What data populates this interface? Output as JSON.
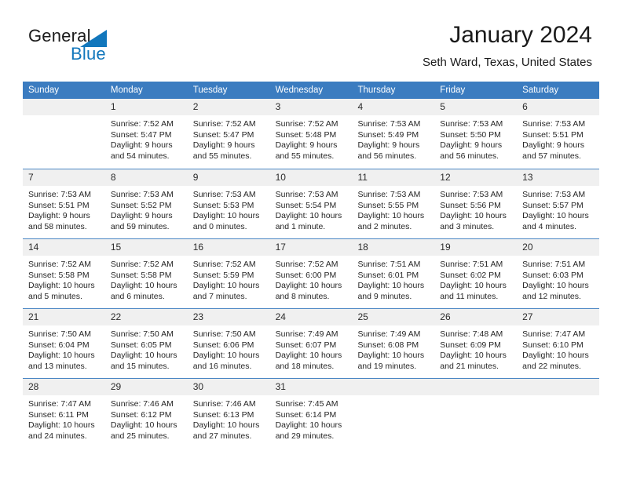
{
  "brand": {
    "word_one": "General",
    "word_two": "Blue",
    "triangle_icon": "triangle-logo-icon",
    "accent_color": "#1277bc"
  },
  "header": {
    "title": "January 2024",
    "subtitle": "Seth Ward, Texas, United States"
  },
  "theme": {
    "header_band": "#3b7cc0",
    "day_strip": "#f0f0f0",
    "row_divider": "#4a86c4",
    "text": "#262626"
  },
  "weekdays": [
    "Sunday",
    "Monday",
    "Tuesday",
    "Wednesday",
    "Thursday",
    "Friday",
    "Saturday"
  ],
  "weeks": [
    [
      {
        "day": "",
        "sunrise": "",
        "sunset": "",
        "daylight": ""
      },
      {
        "day": "1",
        "sunrise": "Sunrise: 7:52 AM",
        "sunset": "Sunset: 5:47 PM",
        "daylight": "Daylight: 9 hours and 54 minutes."
      },
      {
        "day": "2",
        "sunrise": "Sunrise: 7:52 AM",
        "sunset": "Sunset: 5:47 PM",
        "daylight": "Daylight: 9 hours and 55 minutes."
      },
      {
        "day": "3",
        "sunrise": "Sunrise: 7:52 AM",
        "sunset": "Sunset: 5:48 PM",
        "daylight": "Daylight: 9 hours and 55 minutes."
      },
      {
        "day": "4",
        "sunrise": "Sunrise: 7:53 AM",
        "sunset": "Sunset: 5:49 PM",
        "daylight": "Daylight: 9 hours and 56 minutes."
      },
      {
        "day": "5",
        "sunrise": "Sunrise: 7:53 AM",
        "sunset": "Sunset: 5:50 PM",
        "daylight": "Daylight: 9 hours and 56 minutes."
      },
      {
        "day": "6",
        "sunrise": "Sunrise: 7:53 AM",
        "sunset": "Sunset: 5:51 PM",
        "daylight": "Daylight: 9 hours and 57 minutes."
      }
    ],
    [
      {
        "day": "7",
        "sunrise": "Sunrise: 7:53 AM",
        "sunset": "Sunset: 5:51 PM",
        "daylight": "Daylight: 9 hours and 58 minutes."
      },
      {
        "day": "8",
        "sunrise": "Sunrise: 7:53 AM",
        "sunset": "Sunset: 5:52 PM",
        "daylight": "Daylight: 9 hours and 59 minutes."
      },
      {
        "day": "9",
        "sunrise": "Sunrise: 7:53 AM",
        "sunset": "Sunset: 5:53 PM",
        "daylight": "Daylight: 10 hours and 0 minutes."
      },
      {
        "day": "10",
        "sunrise": "Sunrise: 7:53 AM",
        "sunset": "Sunset: 5:54 PM",
        "daylight": "Daylight: 10 hours and 1 minute."
      },
      {
        "day": "11",
        "sunrise": "Sunrise: 7:53 AM",
        "sunset": "Sunset: 5:55 PM",
        "daylight": "Daylight: 10 hours and 2 minutes."
      },
      {
        "day": "12",
        "sunrise": "Sunrise: 7:53 AM",
        "sunset": "Sunset: 5:56 PM",
        "daylight": "Daylight: 10 hours and 3 minutes."
      },
      {
        "day": "13",
        "sunrise": "Sunrise: 7:53 AM",
        "sunset": "Sunset: 5:57 PM",
        "daylight": "Daylight: 10 hours and 4 minutes."
      }
    ],
    [
      {
        "day": "14",
        "sunrise": "Sunrise: 7:52 AM",
        "sunset": "Sunset: 5:58 PM",
        "daylight": "Daylight: 10 hours and 5 minutes."
      },
      {
        "day": "15",
        "sunrise": "Sunrise: 7:52 AM",
        "sunset": "Sunset: 5:58 PM",
        "daylight": "Daylight: 10 hours and 6 minutes."
      },
      {
        "day": "16",
        "sunrise": "Sunrise: 7:52 AM",
        "sunset": "Sunset: 5:59 PM",
        "daylight": "Daylight: 10 hours and 7 minutes."
      },
      {
        "day": "17",
        "sunrise": "Sunrise: 7:52 AM",
        "sunset": "Sunset: 6:00 PM",
        "daylight": "Daylight: 10 hours and 8 minutes."
      },
      {
        "day": "18",
        "sunrise": "Sunrise: 7:51 AM",
        "sunset": "Sunset: 6:01 PM",
        "daylight": "Daylight: 10 hours and 9 minutes."
      },
      {
        "day": "19",
        "sunrise": "Sunrise: 7:51 AM",
        "sunset": "Sunset: 6:02 PM",
        "daylight": "Daylight: 10 hours and 11 minutes."
      },
      {
        "day": "20",
        "sunrise": "Sunrise: 7:51 AM",
        "sunset": "Sunset: 6:03 PM",
        "daylight": "Daylight: 10 hours and 12 minutes."
      }
    ],
    [
      {
        "day": "21",
        "sunrise": "Sunrise: 7:50 AM",
        "sunset": "Sunset: 6:04 PM",
        "daylight": "Daylight: 10 hours and 13 minutes."
      },
      {
        "day": "22",
        "sunrise": "Sunrise: 7:50 AM",
        "sunset": "Sunset: 6:05 PM",
        "daylight": "Daylight: 10 hours and 15 minutes."
      },
      {
        "day": "23",
        "sunrise": "Sunrise: 7:50 AM",
        "sunset": "Sunset: 6:06 PM",
        "daylight": "Daylight: 10 hours and 16 minutes."
      },
      {
        "day": "24",
        "sunrise": "Sunrise: 7:49 AM",
        "sunset": "Sunset: 6:07 PM",
        "daylight": "Daylight: 10 hours and 18 minutes."
      },
      {
        "day": "25",
        "sunrise": "Sunrise: 7:49 AM",
        "sunset": "Sunset: 6:08 PM",
        "daylight": "Daylight: 10 hours and 19 minutes."
      },
      {
        "day": "26",
        "sunrise": "Sunrise: 7:48 AM",
        "sunset": "Sunset: 6:09 PM",
        "daylight": "Daylight: 10 hours and 21 minutes."
      },
      {
        "day": "27",
        "sunrise": "Sunrise: 7:47 AM",
        "sunset": "Sunset: 6:10 PM",
        "daylight": "Daylight: 10 hours and 22 minutes."
      }
    ],
    [
      {
        "day": "28",
        "sunrise": "Sunrise: 7:47 AM",
        "sunset": "Sunset: 6:11 PM",
        "daylight": "Daylight: 10 hours and 24 minutes."
      },
      {
        "day": "29",
        "sunrise": "Sunrise: 7:46 AM",
        "sunset": "Sunset: 6:12 PM",
        "daylight": "Daylight: 10 hours and 25 minutes."
      },
      {
        "day": "30",
        "sunrise": "Sunrise: 7:46 AM",
        "sunset": "Sunset: 6:13 PM",
        "daylight": "Daylight: 10 hours and 27 minutes."
      },
      {
        "day": "31",
        "sunrise": "Sunrise: 7:45 AM",
        "sunset": "Sunset: 6:14 PM",
        "daylight": "Daylight: 10 hours and 29 minutes."
      },
      {
        "day": "",
        "sunrise": "",
        "sunset": "",
        "daylight": ""
      },
      {
        "day": "",
        "sunrise": "",
        "sunset": "",
        "daylight": ""
      },
      {
        "day": "",
        "sunrise": "",
        "sunset": "",
        "daylight": ""
      }
    ]
  ]
}
